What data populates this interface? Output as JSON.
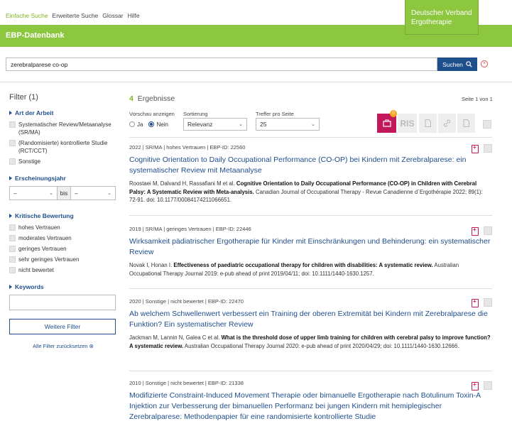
{
  "topnav": [
    "Einfache Suche",
    "Erweiterte Suche",
    "Glossar",
    "Hilfe"
  ],
  "brand": {
    "line1": "Deutscher Verband",
    "line2": "Ergotherapie"
  },
  "db_title": "EBP-Datenbank",
  "search": {
    "value": "zerebralparese co-op",
    "button": "Suchen"
  },
  "sidebar": {
    "filter_title": "Filter (1)",
    "art": {
      "title": "Art der Arbeit",
      "options": [
        "Systematischer Review/Metaanalyse (SR/MA)",
        "(Randomisierte) kontrollierte Studie (RCT/CCT)",
        "Sonstige"
      ]
    },
    "jahr": {
      "title": "Erscheinungsjahr",
      "from": "–",
      "bis": "bis",
      "to": "–"
    },
    "kritisch": {
      "title": "Kritische Bewertung",
      "options": [
        "hohes Vertrauen",
        "moderates Vertrauen",
        "geringes Vertrauen",
        "sehr geringes Vertrauen",
        "nicht bewertet"
      ]
    },
    "keywords": {
      "title": "Keywords"
    },
    "more_button": "Weitere Filter",
    "reset": "Alle Filter zurücksetzen"
  },
  "results_header": {
    "count": "4",
    "count_label": "Ergebnisse",
    "page_info": "Seite 1 von 1",
    "preview_label": "Vorschau anzeigen",
    "preview_yes": "Ja",
    "preview_no": "Nein",
    "sort_label": "Sortierung",
    "sort_value": "Relevanz",
    "per_page_label": "Treffer pro Seite",
    "per_page_value": "25"
  },
  "export": {
    "badge": "0",
    "ris": "RIS"
  },
  "colors": {
    "green": "#8dc63f",
    "blue": "#1f4e8c",
    "magenta": "#c2185b"
  },
  "results": [
    {
      "meta": "2022 | SR/MA | hohes Vertrauen | EBP-ID: 22560",
      "title": "Cognitive Orientation to Daily Occupational Performance (CO-OP) bei Kindern mit Zerebralparese: ein systematischer Review mit Metaanalyse",
      "authors": "Roostaei M, Dalvand H, Rassafiani M et al. ",
      "paper": "Cognitive Orientation to Daily Occupational Performance (CO-OP) in Children with Cerebral Palsy: A Systematic Review with Meta-analysis.",
      "source": " Canadian Journal of Occupational Therapy - Revue Canadienne d´Ergothérapie 2022; 89(1): 72-91. doi: 10.1177/00084174211066651."
    },
    {
      "meta": "2019 | SR/MA | geringes Vertrauen | EBP-ID: 22446",
      "title": "Wirksamkeit pädiatrischer Ergotherapie für Kinder mit Einschränkungen und Behinderung: ein systematischer Review",
      "authors": "Novak I, Honan I. ",
      "paper": "Effectiveness of paediatric occupational therapy for children with disabilities: A systematic review.",
      "source": " Australian Occupational Therapy Journal 2019: e-pub ahead of print 2019/04/11; doi: 10.1111/1440-1630.1257."
    },
    {
      "meta": "2020 | Sonstige | nicht bewertet | EBP-ID: 22470",
      "title": "Ab welchem Schwellenwert verbessert ein Training der oberen Extremität bei Kindern mit Zerebralparese die Funktion? Ein systematischer Review",
      "authors": "Jackman M, Lannin N, Galea C et al. ",
      "paper": "What is the threshold dose of upper limb training for children with cerebral palsy to improve function? A systematic review.",
      "source": " Australian Occupational Therapy Journal 2020: e-pub ahead of print 2020/04/29; doi: 10.1111/1440-1630.12666."
    },
    {
      "meta": "2010 | Sonstige | nicht bewertet | EBP-ID: 21338",
      "title": "Modifizierte Constraint-Induced Movement Therapie oder bimanuelle Ergotherapie nach Botulinum Toxin-A Injektion zur Verbesserung der bimanuellen Performanz bei jungen Kindern mit hemiplegischer Zerebralparese: Methodenpapier für eine randomisierte kontrollierte Studie",
      "authors": "",
      "paper": "",
      "source": ""
    }
  ]
}
